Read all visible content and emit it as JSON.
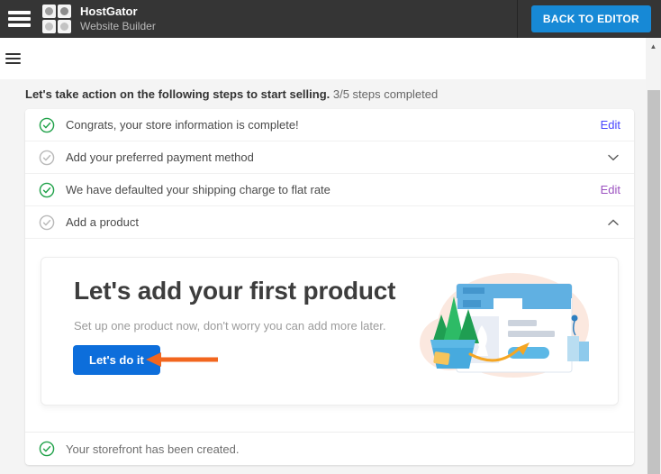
{
  "header": {
    "brand_name": "HostGator",
    "brand_subtitle": "Website Builder",
    "back_button_label": "BACK TO EDITOR"
  },
  "intro": {
    "headline": "Let's take action on the following steps to start selling.",
    "progress": "3/5 steps completed"
  },
  "checklist": {
    "items": [
      {
        "label": "Congrats, your store information is complete!",
        "status": "complete",
        "action_label": "Edit"
      },
      {
        "label": "Add your preferred payment method",
        "status": "incomplete",
        "action_icon": "chevron-down-icon"
      },
      {
        "label": "We have defaulted your shipping charge to flat rate",
        "status": "complete",
        "action_label": "Edit"
      },
      {
        "label": "Add a product",
        "status": "incomplete",
        "action_icon": "chevron-up-icon"
      },
      {
        "label": "Your storefront has been created.",
        "status": "complete"
      }
    ]
  },
  "product_panel": {
    "title": "Let's add your first product",
    "subtitle": "Set up one product now, don't worry you can add more later.",
    "cta_label": "Let's do it"
  },
  "icons": {
    "top_menu": "hamburger-icon",
    "toolbar_menu": "hamburger-icon",
    "complete_check": "check-circle-icon",
    "scroll_up": "scroll-up-arrow-icon",
    "annotation": "orange-arrow-annotation"
  },
  "colors": {
    "header_bg": "#353535",
    "back_button": "#1789d6",
    "cta_button": "#0d6edb",
    "check_complete": "#21a24a",
    "check_incomplete": "#b9b9b9",
    "edit_link_blue": "#4845ff",
    "edit_link_purple": "#9b51c0",
    "annotation_arrow": "#f2661e",
    "page_bg": "#f4f4f4"
  }
}
